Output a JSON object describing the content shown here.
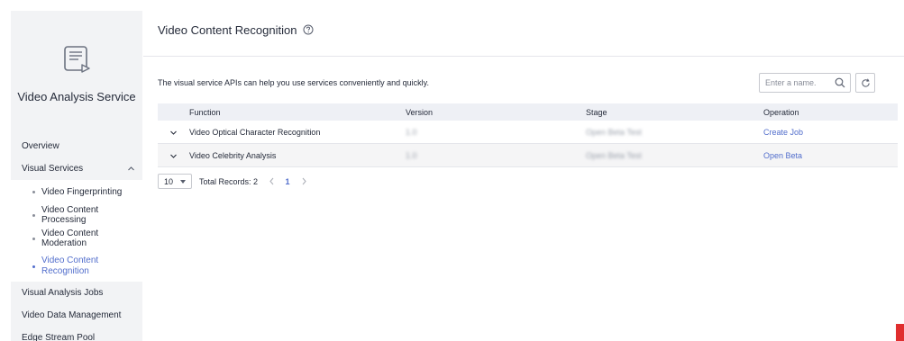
{
  "sidebar": {
    "service_title": "Video Analysis Service",
    "items": [
      {
        "label": "Overview"
      },
      {
        "label": "Visual Services"
      },
      {
        "label": "Visual Analysis Jobs"
      },
      {
        "label": "Video Data Management"
      },
      {
        "label": "Edge Stream Pool"
      }
    ],
    "sub_items": [
      {
        "label": "Video Fingerprinting"
      },
      {
        "label": "Video Content Processing"
      },
      {
        "label": "Video Content Moderation"
      },
      {
        "label": "Video Content Recognition"
      }
    ],
    "active_item": "Video Content Recognition"
  },
  "header": {
    "title": "Video Content Recognition"
  },
  "main": {
    "description": "The visual service APIs can help you use services conveniently and quickly.",
    "search": {
      "placeholder": "Enter a name.",
      "value": ""
    }
  },
  "table": {
    "columns": [
      "Function",
      "Version",
      "Stage",
      "Operation"
    ],
    "rows": [
      {
        "function": "Video Optical Character Recognition",
        "version": "1.0",
        "stage": "Open Beta Test",
        "operation": "Create Job"
      },
      {
        "function": "Video Celebrity Analysis",
        "version": "1.0",
        "stage": "Open Beta Test",
        "operation": "Open Beta"
      }
    ]
  },
  "pagination": {
    "page_size": "10",
    "total_records": "Total Records: 2",
    "current_page": "1"
  },
  "colors": {
    "accent": "#526ecc",
    "sidebar_bg": "#f2f3f5",
    "table_header_bg": "#eef0f5",
    "feedback": "#e02e2e"
  }
}
